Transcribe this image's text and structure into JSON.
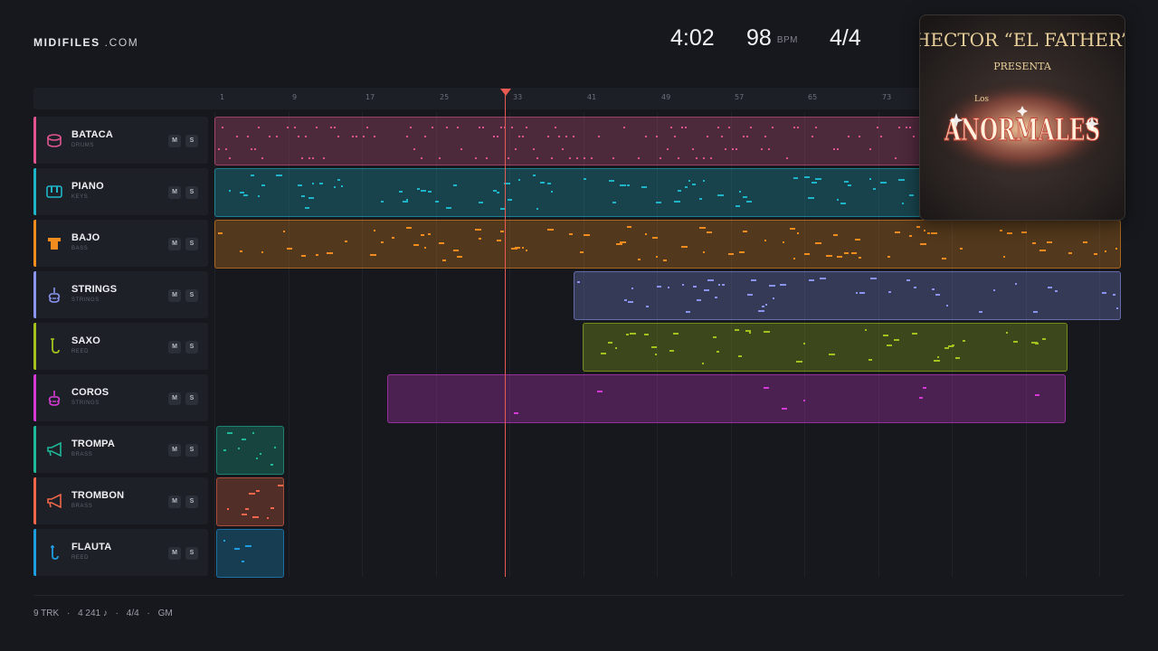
{
  "brand": {
    "bold": "MIDIFILES",
    "rest": ".COM"
  },
  "transport": {
    "duration": "4:02",
    "tempo": "98",
    "tempo_unit": "BPM",
    "time_signature": "4/4"
  },
  "ruler": {
    "bars": [
      "1",
      "9",
      "17",
      "25",
      "33",
      "41",
      "49",
      "57",
      "65",
      "73"
    ]
  },
  "tracks": [
    {
      "name": "BATACA",
      "sub": "DRUMS",
      "color": "#e0558f",
      "icon": "drum-icon",
      "mute": "M",
      "solo": "S"
    },
    {
      "name": "PIANO",
      "sub": "KEYS",
      "color": "#1fb5c9",
      "icon": "piano-icon",
      "mute": "M",
      "solo": "S"
    },
    {
      "name": "BAJO",
      "sub": "BASS",
      "color": "#f28c1e",
      "icon": "bass-icon",
      "mute": "M",
      "solo": "S"
    },
    {
      "name": "STRINGS",
      "sub": "STRINGS",
      "color": "#8a93ee",
      "icon": "violin-icon",
      "mute": "M",
      "solo": "S"
    },
    {
      "name": "SAXO",
      "sub": "REED",
      "color": "#a3c21d",
      "icon": "saxophone-icon",
      "mute": "M",
      "solo": "S"
    },
    {
      "name": "COROS",
      "sub": "STRINGS",
      "color": "#d53ad6",
      "icon": "violin-icon",
      "mute": "M",
      "solo": "S"
    },
    {
      "name": "TROMPA",
      "sub": "BRASS",
      "color": "#1fb89a",
      "icon": "horn-icon",
      "mute": "M",
      "solo": "S"
    },
    {
      "name": "TROMBON",
      "sub": "BRASS",
      "color": "#f2674a",
      "icon": "trombone-icon",
      "mute": "M",
      "solo": "S"
    },
    {
      "name": "FLAUTA",
      "sub": "REED",
      "color": "#1e9de0",
      "icon": "flute-icon",
      "mute": "M",
      "solo": "S"
    }
  ],
  "album_art": {
    "artist": "HECTOR “EL FATHER”",
    "presents": "PRESENTA",
    "los": "Los",
    "title": "ANORMALES"
  },
  "footer": {
    "tracks": "9 TRK",
    "notes": "4 241 ♪",
    "time_signature": "4/4",
    "standard": "GM",
    "separator": "·"
  }
}
